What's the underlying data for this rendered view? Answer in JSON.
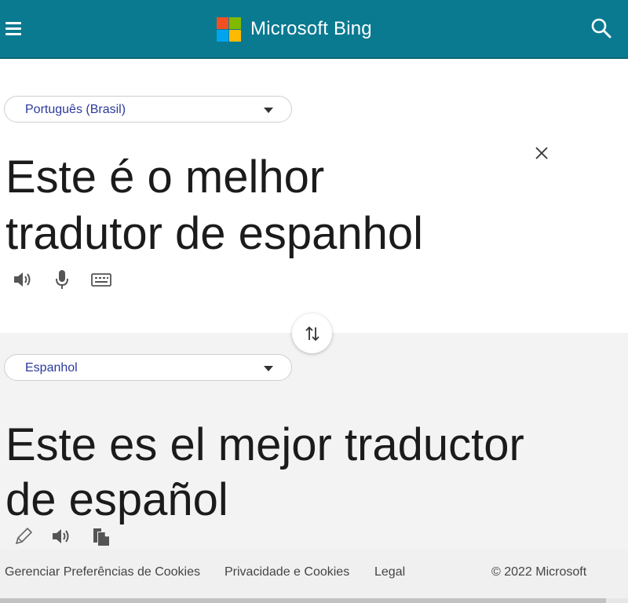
{
  "header": {
    "brand": "Microsoft Bing",
    "logo_colors": [
      "#f25022",
      "#7fba00",
      "#00a4ef",
      "#ffb900"
    ],
    "bar_color": "#0a7a91",
    "menu_icon": "hamburger-menu-icon",
    "search_icon": "search-icon"
  },
  "source": {
    "language": "Português (Brasil)",
    "text_line1": "Este é o melhor",
    "text_line2": "tradutor de espanhol",
    "actions": [
      "speaker-icon",
      "microphone-icon",
      "keyboard-icon"
    ],
    "clear_icon": "close-icon"
  },
  "swap_icon": "swap-languages-icon",
  "target": {
    "language": "Espanhol",
    "text_line1": "Este es el mejor traductor",
    "text_line2": "de español",
    "actions": [
      "edit-pencil-icon",
      "speaker-icon",
      "copy-icon"
    ]
  },
  "footer": {
    "links": [
      "Gerenciar Preferências de Cookies",
      "Privacidade e Cookies",
      "Legal"
    ],
    "copyright": "© 2022 Microsoft"
  }
}
